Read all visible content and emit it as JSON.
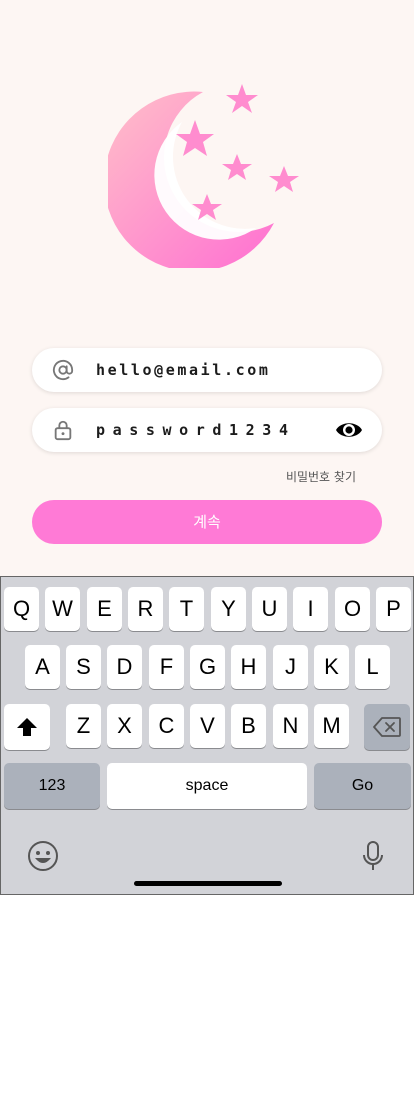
{
  "login": {
    "email_value": "hello@email.com",
    "password_value": "password1234",
    "forgot_password_label": "비밀번호 찾기",
    "continue_label": "계속"
  },
  "icons": {
    "email_icon": "at-sign-icon",
    "password_icon": "lock-icon",
    "toggle_icon": "eye-icon",
    "logo": "crescent-moon-stars-logo"
  },
  "colors": {
    "background": "#fdf6f3",
    "accent": "#ff7ad6",
    "logo_pink_light": "#ffb6c8",
    "logo_pink": "#ff7ad6",
    "keyboard_bg": "#d2d3d8",
    "key_gray": "#abb1bb"
  },
  "keyboard": {
    "row1": [
      "Q",
      "W",
      "E",
      "R",
      "T",
      "Y",
      "U",
      "I",
      "O",
      "P"
    ],
    "row2": [
      "A",
      "S",
      "D",
      "F",
      "G",
      "H",
      "J",
      "K",
      "L"
    ],
    "row3": [
      "Z",
      "X",
      "C",
      "V",
      "B",
      "N",
      "M"
    ],
    "numbers_label": "123",
    "space_label": "space",
    "go_label": "Go"
  }
}
